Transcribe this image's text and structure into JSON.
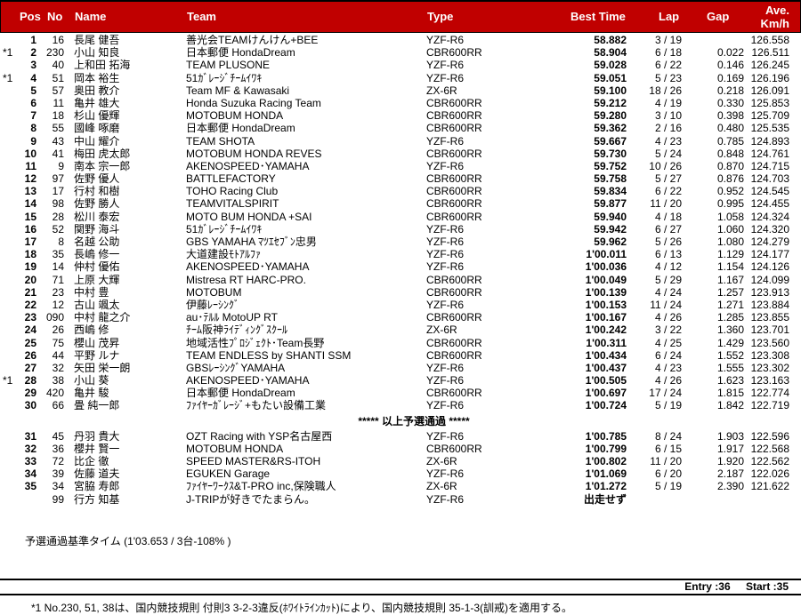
{
  "header": {
    "pos": "Pos",
    "no": "No",
    "name": "Name",
    "team": "Team",
    "type": "Type",
    "best_time": "Best Time",
    "lap": "Lap",
    "gap": "Gap",
    "ave_line1": "Ave.",
    "ave_line2": "Km/h"
  },
  "colors": {
    "header_bg": "#c00000",
    "header_text": "#ffffff"
  },
  "rows": [
    {
      "note": "",
      "pos": "1",
      "no": "16",
      "name": "長尾 健吾",
      "team": "善光会TEAMけんけん+BEE",
      "type": "YZF-R6",
      "best": "58.882",
      "lap": "3 / 19",
      "gap": "",
      "ave": "126.558"
    },
    {
      "note": "*1",
      "pos": "2",
      "no": "230",
      "name": "小山 知良",
      "team": "日本郵便 HondaDream",
      "type": "CBR600RR",
      "best": "58.904",
      "lap": "6 / 18",
      "gap": "0.022",
      "ave": "126.511"
    },
    {
      "note": "",
      "pos": "3",
      "no": "40",
      "name": "上和田 拓海",
      "team": "TEAM PLUSONE",
      "type": "YZF-R6",
      "best": "59.028",
      "lap": "6 / 22",
      "gap": "0.146",
      "ave": "126.245"
    },
    {
      "note": "*1",
      "pos": "4",
      "no": "51",
      "name": "岡本 裕生",
      "team": "51ｶﾞﾚｰｼﾞﾁｰﾑｲﾜｷ",
      "type": "YZF-R6",
      "best": "59.051",
      "lap": "5 / 23",
      "gap": "0.169",
      "ave": "126.196"
    },
    {
      "note": "",
      "pos": "5",
      "no": "57",
      "name": "奥田 教介",
      "team": "Team MF & Kawasaki",
      "type": "ZX-6R",
      "best": "59.100",
      "lap": "18 / 26",
      "gap": "0.218",
      "ave": "126.091"
    },
    {
      "note": "",
      "pos": "6",
      "no": "11",
      "name": "亀井 雄大",
      "team": "Honda Suzuka Racing Team",
      "type": "CBR600RR",
      "best": "59.212",
      "lap": "4 / 19",
      "gap": "0.330",
      "ave": "125.853"
    },
    {
      "note": "",
      "pos": "7",
      "no": "18",
      "name": "杉山 優輝",
      "team": "MOTOBUM HONDA",
      "type": "CBR600RR",
      "best": "59.280",
      "lap": "3 / 10",
      "gap": "0.398",
      "ave": "125.709"
    },
    {
      "note": "",
      "pos": "8",
      "no": "55",
      "name": "國峰 啄磨",
      "team": "日本郵便 HondaDream",
      "type": "CBR600RR",
      "best": "59.362",
      "lap": "2 / 16",
      "gap": "0.480",
      "ave": "125.535"
    },
    {
      "note": "",
      "pos": "9",
      "no": "43",
      "name": "中山 耀介",
      "team": "TEAM SHOTA",
      "type": "YZF-R6",
      "best": "59.667",
      "lap": "4 / 23",
      "gap": "0.785",
      "ave": "124.893"
    },
    {
      "note": "",
      "pos": "10",
      "no": "41",
      "name": "梅田 虎太郎",
      "team": "MOTOBUM HONDA REVES",
      "type": "CBR600RR",
      "best": "59.730",
      "lap": "5 / 24",
      "gap": "0.848",
      "ave": "124.761"
    },
    {
      "note": "",
      "pos": "11",
      "no": "9",
      "name": "南本 宗一郎",
      "team": "AKENOSPEED･YAMAHA",
      "type": "YZF-R6",
      "best": "59.752",
      "lap": "10 / 26",
      "gap": "0.870",
      "ave": "124.715"
    },
    {
      "note": "",
      "pos": "12",
      "no": "97",
      "name": "佐野 優人",
      "team": "BATTLEFACTORY",
      "type": "CBR600RR",
      "best": "59.758",
      "lap": "5 / 27",
      "gap": "0.876",
      "ave": "124.703"
    },
    {
      "note": "",
      "pos": "13",
      "no": "17",
      "name": "行村 和樹",
      "team": "TOHO Racing Club",
      "type": "CBR600RR",
      "best": "59.834",
      "lap": "6 / 22",
      "gap": "0.952",
      "ave": "124.545"
    },
    {
      "note": "",
      "pos": "14",
      "no": "98",
      "name": "佐野 勝人",
      "team": "TEAMVITALSPIRIT",
      "type": "CBR600RR",
      "best": "59.877",
      "lap": "11 / 20",
      "gap": "0.995",
      "ave": "124.455"
    },
    {
      "note": "",
      "pos": "15",
      "no": "28",
      "name": "松川 泰宏",
      "team": "MOTO BUM HONDA +SAI",
      "type": "CBR600RR",
      "best": "59.940",
      "lap": "4 / 18",
      "gap": "1.058",
      "ave": "124.324"
    },
    {
      "note": "",
      "pos": "16",
      "no": "52",
      "name": "関野 海斗",
      "team": "51ｶﾞﾚｰｼﾞﾁｰﾑｲﾜｷ",
      "type": "YZF-R6",
      "best": "59.942",
      "lap": "6 / 27",
      "gap": "1.060",
      "ave": "124.320"
    },
    {
      "note": "",
      "pos": "17",
      "no": "8",
      "name": "名越 公助",
      "team": "GBS YAMAHA ﾏﾂｴｾﾌﾞﾝ忠男",
      "type": "YZF-R6",
      "best": "59.962",
      "lap": "5 / 26",
      "gap": "1.080",
      "ave": "124.279"
    },
    {
      "note": "",
      "pos": "18",
      "no": "35",
      "name": "長嶋 修一",
      "team": "大道建設ﾓﾄｱﾙﾌｧ",
      "type": "YZF-R6",
      "best": "1'00.011",
      "lap": "6 / 13",
      "gap": "1.129",
      "ave": "124.177"
    },
    {
      "note": "",
      "pos": "19",
      "no": "14",
      "name": "仲村 優佑",
      "team": "AKENOSPEED･YAMAHA",
      "type": "YZF-R6",
      "best": "1'00.036",
      "lap": "4 / 12",
      "gap": "1.154",
      "ave": "124.126"
    },
    {
      "note": "",
      "pos": "20",
      "no": "71",
      "name": "上原 大輝",
      "team": "Mistresa RT HARC-PRO.",
      "type": "CBR600RR",
      "best": "1'00.049",
      "lap": "5 / 29",
      "gap": "1.167",
      "ave": "124.099"
    },
    {
      "note": "",
      "pos": "21",
      "no": "23",
      "name": "中村  豊",
      "team": "MOTOBUM",
      "type": "CBR600RR",
      "best": "1'00.139",
      "lap": "4 / 24",
      "gap": "1.257",
      "ave": "123.913"
    },
    {
      "note": "",
      "pos": "22",
      "no": "12",
      "name": "古山 颯太",
      "team": "伊藤ﾚｰｼﾝｸﾞ",
      "type": "YZF-R6",
      "best": "1'00.153",
      "lap": "11 / 24",
      "gap": "1.271",
      "ave": "123.884"
    },
    {
      "note": "",
      "pos": "23",
      "no": "090",
      "name": "中村 龍之介",
      "team": "au･ﾃﾙﾙ MotoUP RT",
      "type": "CBR600RR",
      "best": "1'00.167",
      "lap": "4 / 26",
      "gap": "1.285",
      "ave": "123.855"
    },
    {
      "note": "",
      "pos": "24",
      "no": "26",
      "name": "西嶋  修",
      "team": "ﾁｰﾑ阪神ﾗｲﾃﾞｨﾝｸﾞｽｸｰﾙ",
      "type": "ZX-6R",
      "best": "1'00.242",
      "lap": "3 / 22",
      "gap": "1.360",
      "ave": "123.701"
    },
    {
      "note": "",
      "pos": "25",
      "no": "75",
      "name": "櫻山 茂昇",
      "team": "地域活性ﾌﾟﾛｼﾞｪｸﾄ･Team長野",
      "type": "CBR600RR",
      "best": "1'00.311",
      "lap": "4 / 25",
      "gap": "1.429",
      "ave": "123.560"
    },
    {
      "note": "",
      "pos": "26",
      "no": "44",
      "name": "平野 ルナ",
      "team": "TEAM ENDLESS by SHANTI SSM",
      "type": "CBR600RR",
      "best": "1'00.434",
      "lap": "6 / 24",
      "gap": "1.552",
      "ave": "123.308"
    },
    {
      "note": "",
      "pos": "27",
      "no": "32",
      "name": "矢田 栄一朗",
      "team": "GBSﾚｰｼﾝｸﾞYAMAHA",
      "type": "YZF-R6",
      "best": "1'00.437",
      "lap": "4 / 23",
      "gap": "1.555",
      "ave": "123.302"
    },
    {
      "note": "*1",
      "pos": "28",
      "no": "38",
      "name": "小山  葵",
      "team": "AKENOSPEED･YAMAHA",
      "type": "YZF-R6",
      "best": "1'00.505",
      "lap": "4 / 26",
      "gap": "1.623",
      "ave": "123.163"
    },
    {
      "note": "",
      "pos": "29",
      "no": "420",
      "name": "亀井  駿",
      "team": "日本郵便 HondaDream",
      "type": "CBR600RR",
      "best": "1'00.697",
      "lap": "17 / 24",
      "gap": "1.815",
      "ave": "122.774"
    },
    {
      "note": "",
      "pos": "30",
      "no": "66",
      "name": "畳 純一郎",
      "team": "ﾌｧｲﾔｰｶﾞﾚｰｼﾞ+もたい設備工業",
      "type": "YZF-R6",
      "best": "1'00.724",
      "lap": "5 / 19",
      "gap": "1.842",
      "ave": "122.719"
    }
  ],
  "separator": "***** 以上予選通過 *****",
  "rows_after": [
    {
      "note": "",
      "pos": "31",
      "no": "45",
      "name": "丹羽 貴大",
      "team": "OZT Racing with YSP名古屋西",
      "type": "YZF-R6",
      "best": "1'00.785",
      "lap": "8 / 24",
      "gap": "1.903",
      "ave": "122.596"
    },
    {
      "note": "",
      "pos": "32",
      "no": "36",
      "name": "櫻井 賢一",
      "team": "MOTOBUM HONDA",
      "type": "CBR600RR",
      "best": "1'00.799",
      "lap": "6 / 15",
      "gap": "1.917",
      "ave": "122.568"
    },
    {
      "note": "",
      "pos": "33",
      "no": "72",
      "name": "比企  徹",
      "team": "SPEED MASTER&RS-ITOH",
      "type": "ZX-6R",
      "best": "1'00.802",
      "lap": "11 / 20",
      "gap": "1.920",
      "ave": "122.562"
    },
    {
      "note": "",
      "pos": "34",
      "no": "39",
      "name": "佐藤 道夫",
      "team": "EGUKEN Garage",
      "type": "YZF-R6",
      "best": "1'01.069",
      "lap": "6 / 20",
      "gap": "2.187",
      "ave": "122.026"
    },
    {
      "note": "",
      "pos": "35",
      "no": "34",
      "name": "宮脇  寿郎",
      "team": "ﾌｧｲﾔｰﾜｰｸｽ&T-PRO inc,保険職人",
      "type": "ZX-6R",
      "best": "1'01.272",
      "lap": "5 / 19",
      "gap": "2.390",
      "ave": "121.622"
    },
    {
      "note": "",
      "pos": "",
      "no": "99",
      "name": "行方 知基",
      "team": "J-TRIPが好きでたまらん。",
      "type": "YZF-R6",
      "best": "出走せず",
      "lap": "",
      "gap": "",
      "ave": ""
    }
  ],
  "qualifying_standard": "予選通過基準タイム (1'03.653 / 3台-108% )",
  "entry": "Entry :36",
  "start": "Start :35",
  "footnote": "*1 No.230, 51, 38は、国内競技規則  付則3  3-2-3違反(ﾎﾜｲﾄﾗｲﾝｶｯﾄ)により、国内競技規則  35-1-3(訓戒)を適用する。"
}
